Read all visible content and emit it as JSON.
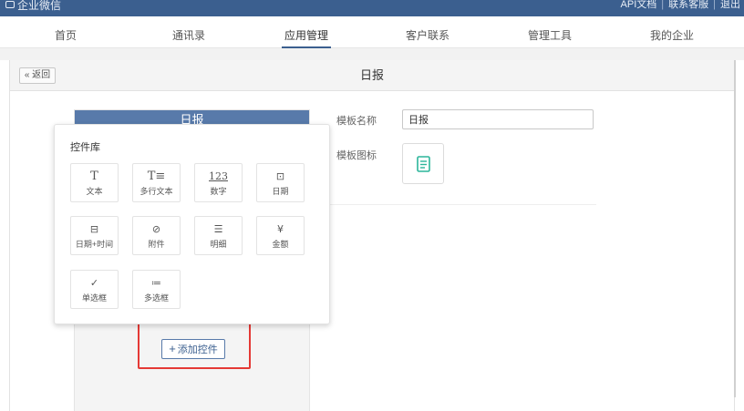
{
  "topbar": {
    "brand": "企业微信",
    "links": [
      "API文档",
      "联系客服",
      "退出"
    ]
  },
  "nav": {
    "items": [
      "首页",
      "通讯录",
      "应用管理",
      "客户联系",
      "管理工具",
      "我的企业"
    ],
    "active_index": 2
  },
  "page": {
    "back_label": "« 返回",
    "title": "日报"
  },
  "preview": {
    "header": "日报",
    "add_button_label": "添加控件"
  },
  "form": {
    "name_label": "模板名称",
    "name_value": "日报",
    "icon_label": "模板图标",
    "icon_color": "#2bb59a"
  },
  "library": {
    "title": "控件库",
    "controls": [
      {
        "glyph": "T",
        "label": "文本",
        "icon": "text-icon"
      },
      {
        "glyph": "T≡",
        "label": "多行文本",
        "icon": "multiline-text-icon"
      },
      {
        "glyph": "123",
        "label": "数字",
        "icon": "number-icon"
      },
      {
        "glyph": "⊡",
        "label": "日期",
        "icon": "date-icon"
      },
      {
        "glyph": "⊟",
        "label": "日期+时间",
        "icon": "datetime-icon"
      },
      {
        "glyph": "⊘",
        "label": "附件",
        "icon": "attachment-icon"
      },
      {
        "glyph": "☰",
        "label": "明细",
        "icon": "detail-icon"
      },
      {
        "glyph": "¥",
        "label": "金额",
        "icon": "amount-icon"
      },
      {
        "glyph": "✓",
        "label": "单选框",
        "icon": "radio-icon"
      },
      {
        "glyph": "≔",
        "label": "多选框",
        "icon": "checkbox-icon"
      }
    ]
  }
}
